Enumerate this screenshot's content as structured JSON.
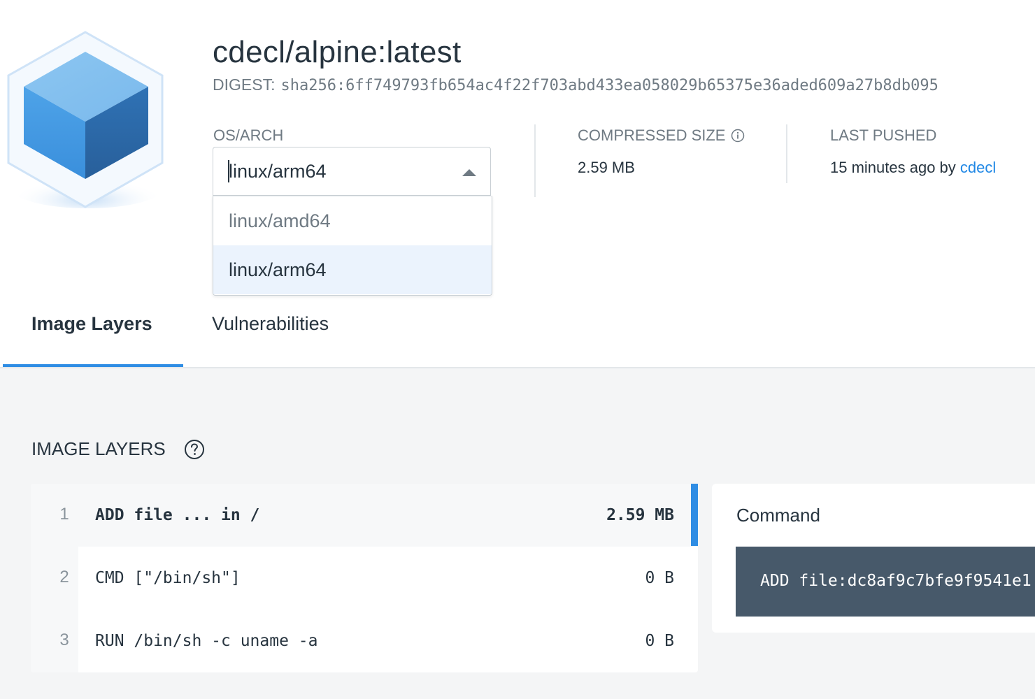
{
  "image": {
    "title": "cdecl/alpine:latest",
    "digest_label": "DIGEST:",
    "digest_value": "sha256:6ff749793fb654ac4f22f703abd433ea058029b65375e36aded609a27b8db095"
  },
  "osarch": {
    "label": "OS/ARCH",
    "selected": "linux/arm64",
    "options": [
      "linux/amd64",
      "linux/arm64"
    ]
  },
  "compressed_size": {
    "label": "COMPRESSED SIZE",
    "value": "2.59 MB"
  },
  "last_pushed": {
    "label": "LAST PUSHED",
    "value_prefix": "15 minutes ago by",
    "user": "cdecl"
  },
  "tabs": [
    {
      "label": "Image Layers",
      "active": true
    },
    {
      "label": "Vulnerabilities",
      "active": false
    }
  ],
  "layers_section": {
    "title": "IMAGE LAYERS",
    "layers": [
      {
        "num": "1",
        "command": "ADD file ... in /",
        "size": "2.59 MB"
      },
      {
        "num": "2",
        "command": "CMD [\"/bin/sh\"]",
        "size": "0 B"
      },
      {
        "num": "3",
        "command": "RUN /bin/sh -c uname -a",
        "size": "0 B"
      }
    ]
  },
  "command_panel": {
    "title": "Command",
    "text": "ADD file:dc8af9c7bfe9f9541e1"
  },
  "colors": {
    "accent": "#2f8de4",
    "link": "#1f87e5",
    "command_bg": "#47596a",
    "selected_option_bg": "#ebf3fd"
  }
}
